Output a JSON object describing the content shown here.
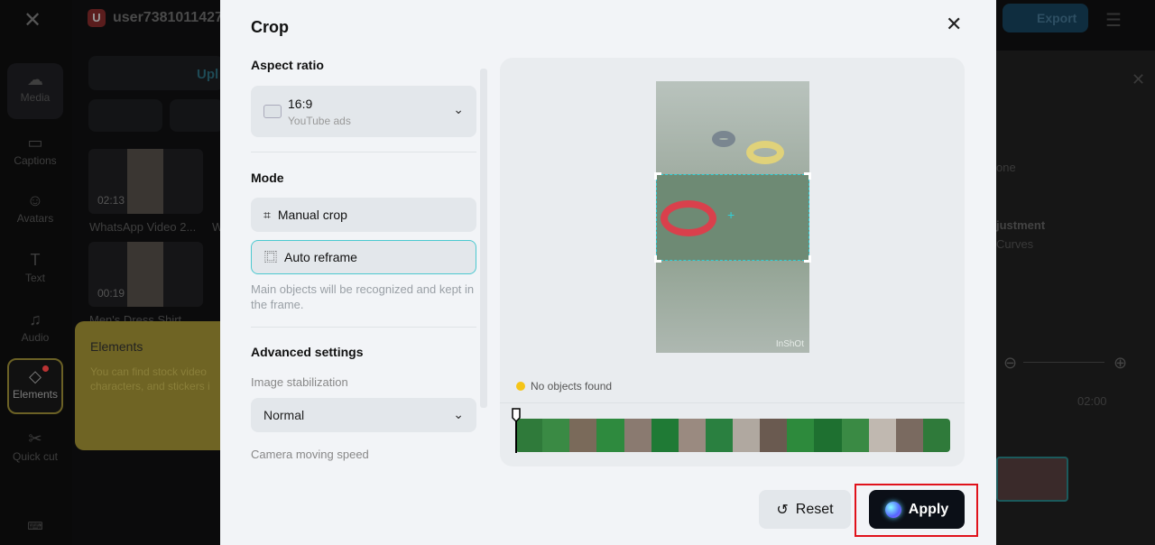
{
  "background": {
    "sidebar": [
      {
        "label": "Media",
        "icon": "cloud-upload-icon"
      },
      {
        "label": "Captions",
        "icon": "captions-icon"
      },
      {
        "label": "Avatars",
        "icon": "avatar-icon"
      },
      {
        "label": "Text",
        "icon": "text-icon"
      },
      {
        "label": "Audio",
        "icon": "music-icon"
      },
      {
        "label": "Elements",
        "icon": "elements-icon"
      },
      {
        "label": "Quick cut",
        "icon": "quick-cut-icon"
      }
    ],
    "user": {
      "initial": "U",
      "name": "user7381011427"
    },
    "upload_label": "Upl",
    "media": [
      {
        "duration": "02:13",
        "name": "WhatsApp Video 2..."
      },
      {
        "duration": "00:19",
        "name": "Men's Dress Shirt"
      }
    ],
    "media_second_col_label": "W",
    "tooltip": {
      "title": "Elements",
      "text_line1": "You can find stock video",
      "text_line2": "characters, and stickers i"
    },
    "export_label": "Export",
    "right_panel": {
      "item1": "one",
      "item2_title": "justment",
      "item2_sub": "Curves",
      "timecode": "02:00"
    }
  },
  "modal": {
    "title": "Crop",
    "aspect_ratio": {
      "heading": "Aspect ratio",
      "value": "16:9",
      "sub": "YouTube ads"
    },
    "mode": {
      "heading": "Mode",
      "options": [
        {
          "label": "Manual crop",
          "icon": "crop-icon",
          "selected": false
        },
        {
          "label": "Auto reframe",
          "icon": "auto-reframe-icon",
          "selected": true
        }
      ],
      "hint": "Main objects will be recognized and kept in the frame."
    },
    "advanced": {
      "heading": "Advanced settings",
      "stabilization_label": "Image stabilization",
      "stabilization_value": "Normal",
      "speed_label": "Camera moving speed"
    },
    "preview": {
      "watermark": "InShOt",
      "status": "No objects found"
    },
    "reset_label": "Reset",
    "apply_label": "Apply",
    "colors": {
      "accent": "#2fd0d8",
      "apply_bg": "#0b0f17",
      "highlight": "#e0121b",
      "warning": "#f5c518"
    }
  }
}
